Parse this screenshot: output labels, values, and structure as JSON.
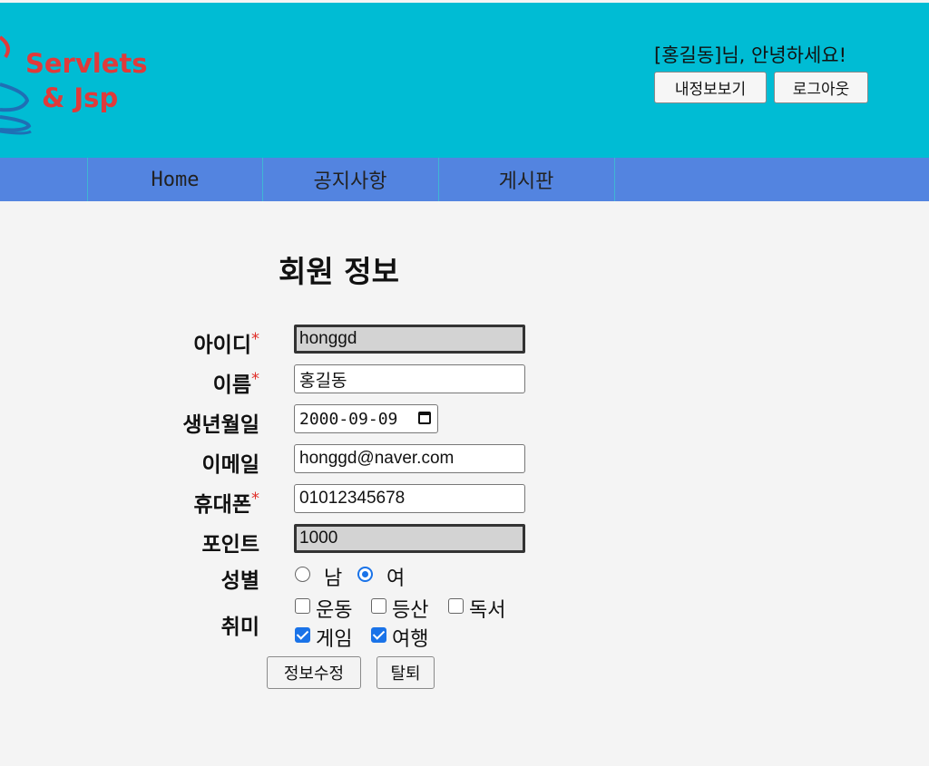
{
  "header": {
    "logo": {
      "line1": "Servlets",
      "line2": "& Jsp"
    },
    "welcome": "[홍길동]님, 안녕하세요!",
    "my_info_button": "내정보보기",
    "logout_button": "로그아웃",
    "background_color": "#00bcd4"
  },
  "nav": {
    "background_color": "#5384e0",
    "items": [
      {
        "label": "Home"
      },
      {
        "label": "공지사항"
      },
      {
        "label": "게시판"
      }
    ]
  },
  "form": {
    "title": "회원 정보",
    "required_mark": "*",
    "fields": {
      "id": {
        "label": "아이디",
        "value": "honggd",
        "required": true,
        "readonly": true
      },
      "name": {
        "label": "이름",
        "value": "홍길동",
        "required": true
      },
      "birthday": {
        "label": "생년월일",
        "value": "2000-09-09"
      },
      "email": {
        "label": "이메일",
        "value": "honggd@naver.com"
      },
      "phone": {
        "label": "휴대폰",
        "value": "01012345678",
        "required": true
      },
      "point": {
        "label": "포인트",
        "value": "1000",
        "readonly": true
      }
    },
    "gender": {
      "label": "성별",
      "options": [
        {
          "label": "남",
          "checked": false
        },
        {
          "label": "여",
          "checked": true
        }
      ]
    },
    "hobby": {
      "label": "취미",
      "options": [
        {
          "label": "운동",
          "checked": false
        },
        {
          "label": "등산",
          "checked": false
        },
        {
          "label": "독서",
          "checked": false
        },
        {
          "label": "게임",
          "checked": true
        },
        {
          "label": "여행",
          "checked": true
        }
      ]
    },
    "submit_button": "정보수정",
    "delete_button": "탈퇴"
  },
  "colors": {
    "page_background": "#f4f4f4",
    "logo_text": "#e03a3a",
    "required_mark": "#e0302a",
    "accent": "#1a73e8"
  }
}
